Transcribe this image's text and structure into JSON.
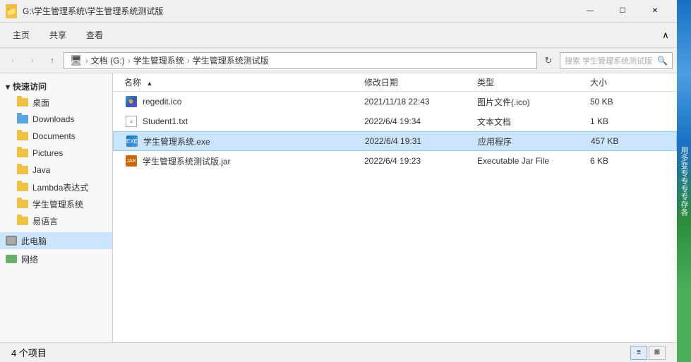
{
  "titlebar": {
    "path": "G:\\学生管理系统\\学生管理系统测试版",
    "controls": {
      "minimize": "—",
      "maximize": "☐",
      "close": "✕"
    }
  },
  "ribbon": {
    "tabs": [
      "主页",
      "共享",
      "查看"
    ],
    "expand_label": "∧"
  },
  "navbar": {
    "back": "‹",
    "forward": "›",
    "up": "↑",
    "address": {
      "parts": [
        "此电脑",
        "文档 (G:)",
        "学生管理系统",
        "学生管理系统测试版"
      ],
      "separator": "›"
    },
    "search_placeholder": "搜索 学生管理系统测试版",
    "refresh": "↻"
  },
  "sidebar": {
    "quickaccess_label": "快速访问",
    "items": [
      {
        "id": "desktop",
        "label": "桌面",
        "icon": "folder"
      },
      {
        "id": "downloads",
        "label": "Downloads",
        "icon": "downloads"
      },
      {
        "id": "documents",
        "label": "Documents",
        "icon": "folder"
      },
      {
        "id": "pictures",
        "label": "Pictures",
        "icon": "folder"
      },
      {
        "id": "java",
        "label": "Java",
        "icon": "folder"
      },
      {
        "id": "lambda",
        "label": "Lambda表达式",
        "icon": "folder"
      },
      {
        "id": "student-sys",
        "label": "学生管理系统",
        "icon": "folder"
      },
      {
        "id": "easy-lang",
        "label": "易语言",
        "icon": "folder"
      }
    ],
    "this_pc_label": "此电脑",
    "network_label": "网络"
  },
  "columns": {
    "name": "名称",
    "date": "修改日期",
    "type": "类型",
    "size": "大小"
  },
  "files": [
    {
      "name": "regedit.ico",
      "date": "2021/11/18 22:43",
      "type": "图片文件(.ico)",
      "size": "50 KB",
      "icon": "ico",
      "selected": false
    },
    {
      "name": "Student1.txt",
      "date": "2022/6/4 19:34",
      "type": "文本文档",
      "size": "1 KB",
      "icon": "txt",
      "selected": false
    },
    {
      "name": "学生管理系统.exe",
      "date": "2022/6/4 19:31",
      "type": "应用程序",
      "size": "457 KB",
      "icon": "exe",
      "selected": true
    },
    {
      "name": "学生管理系统测试版.jar",
      "date": "2022/6/4 19:23",
      "type": "Executable Jar File",
      "size": "6 KB",
      "icon": "jar",
      "selected": false
    }
  ],
  "statusbar": {
    "count": "4 个项目",
    "view_detail_label": "≡",
    "view_tile_label": "⊞"
  }
}
